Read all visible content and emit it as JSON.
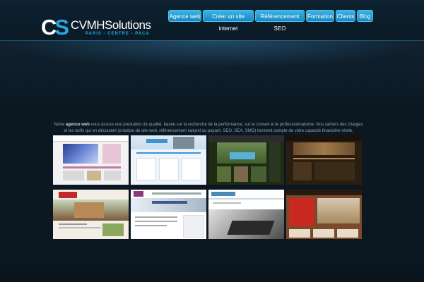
{
  "logo": {
    "monogram_c": "C",
    "monogram_s": "S",
    "name": "CVMHSolutions",
    "tagline": "PARIS - CENTRE - PACA"
  },
  "nav": {
    "items": [
      {
        "label": "Agence web"
      },
      {
        "label": "Créer un site internet"
      },
      {
        "label": "Référencement SEO"
      },
      {
        "label": "Formation"
      },
      {
        "label": "Clients"
      },
      {
        "label": "Blog"
      }
    ]
  },
  "intro": {
    "text_before": "Notre ",
    "highlight": "agence web",
    "text_after": " vous assure une prestation de qualité, basée sur la recherche de la performance, sur le conseil et le professionnalisme. Nos cahiers des charges et les tarifs qui en découlent (création de site web, référencement naturel ou payant, SEO, SEA, SMO) tiennent compte de votre capacité financière réelle."
  },
  "colors": {
    "accent": "#29a6dc",
    "nav_button": "#1b86bf",
    "background": "#0b1720"
  },
  "portfolio": {
    "thumbnails": [
      {
        "name": "portfolio-thumb-jewelry"
      },
      {
        "name": "portfolio-thumb-plugin"
      },
      {
        "name": "portfolio-thumb-pool"
      },
      {
        "name": "portfolio-thumb-hotel"
      },
      {
        "name": "portfolio-thumb-house"
      },
      {
        "name": "portfolio-thumb-gip"
      },
      {
        "name": "portfolio-thumb-laptop"
      },
      {
        "name": "portfolio-thumb-realestate"
      }
    ]
  }
}
